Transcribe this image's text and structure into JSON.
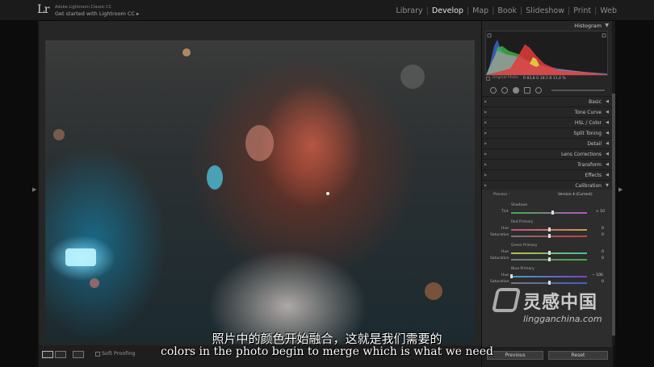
{
  "app": {
    "logo": "Lr",
    "title": "Adobe Lightroom Classic CC",
    "subtitle": "Get started with Lightroom CC ▸"
  },
  "modules": [
    {
      "label": "Library",
      "active": false
    },
    {
      "label": "Develop",
      "active": true
    },
    {
      "label": "Map",
      "active": false
    },
    {
      "label": "Book",
      "active": false
    },
    {
      "label": "Slideshow",
      "active": false
    },
    {
      "label": "Print",
      "active": false
    },
    {
      "label": "Web",
      "active": false
    }
  ],
  "histogram": {
    "title": "Histogram",
    "values": "R  83,8  G  18,5  B  11,4 %",
    "original_photo": "Original Photo"
  },
  "sections": [
    {
      "label": "Basic"
    },
    {
      "label": "Tone Curve"
    },
    {
      "label": "HSL / Color"
    },
    {
      "label": "Split Toning"
    },
    {
      "label": "Detail"
    },
    {
      "label": "Lens Corrections"
    },
    {
      "label": "Transform"
    },
    {
      "label": "Effects"
    },
    {
      "label": "Calibration",
      "expanded": true
    }
  ],
  "calibration": {
    "process_label": "Process :",
    "process_value": "Version 4 (Current)",
    "shadows": {
      "title": "Shadows",
      "tint_label": "Tint",
      "tint_value": "+ 10",
      "tint_level": 0.55
    },
    "red": {
      "title": "Red Primary",
      "hue_label": "Hue",
      "hue_value": "0",
      "sat_label": "Saturation",
      "sat_value": "0",
      "hue_level": 0.5,
      "sat_level": 0.5
    },
    "green": {
      "title": "Green Primary",
      "hue_label": "Hue",
      "hue_value": "0",
      "sat_label": "Saturation",
      "sat_value": "0",
      "hue_level": 0.5,
      "sat_level": 0.5
    },
    "blue": {
      "title": "Blue Primary",
      "hue_label": "Hue",
      "hue_value": "− 100",
      "sat_label": "Saturation",
      "sat_value": "0",
      "hue_level": 0.0,
      "sat_level": 0.5
    }
  },
  "toolbar": {
    "soft_proofing": "Soft Proofing"
  },
  "panel_buttons": {
    "previous": "Previous",
    "reset": "Reset"
  },
  "subtitles": {
    "chinese": "照片中的颜色开始融合，这就是我们需要的",
    "english": "colors in the photo begin to merge which is what we need"
  },
  "watermark": {
    "cn": "灵感中国",
    "en": "lingganchina.com"
  },
  "colors": {
    "hist_red": "#e23c3c",
    "hist_yellow": "#e0d43a",
    "hist_green": "#3fbf4a",
    "hist_blue": "#3c6de0"
  }
}
